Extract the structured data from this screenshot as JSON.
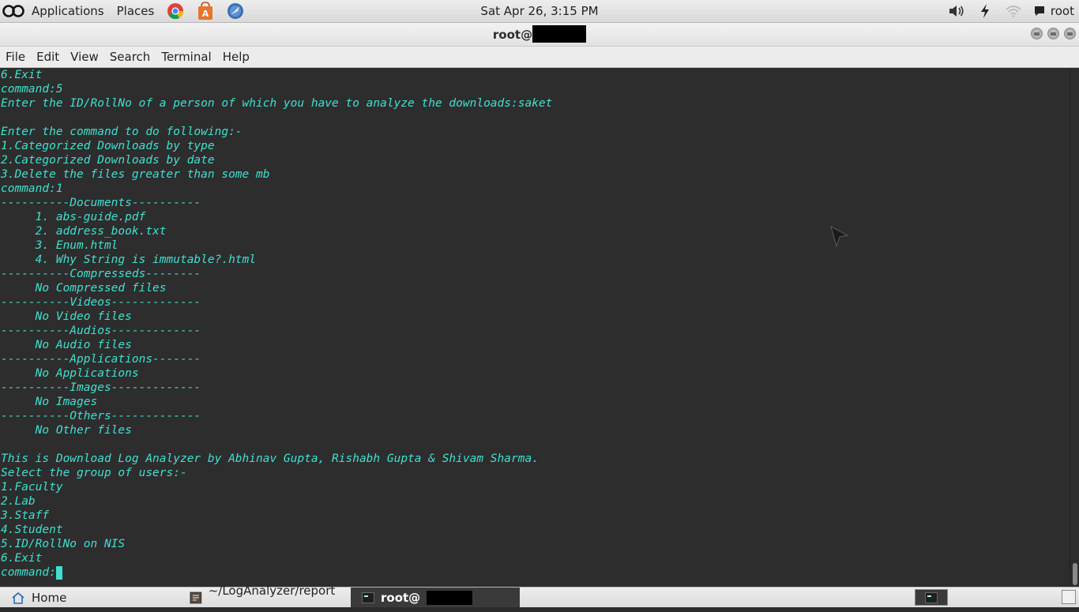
{
  "top_panel": {
    "menus": [
      "Applications",
      "Places"
    ],
    "launchers": [
      "chrome-icon",
      "software-center-icon",
      "network-globe-icon"
    ],
    "clock": "Sat Apr 26,  3:15 PM",
    "user": "root"
  },
  "window": {
    "title_prefix": "root@"
  },
  "menubar": {
    "items": [
      "File",
      "Edit",
      "View",
      "Search",
      "Terminal",
      "Help"
    ]
  },
  "terminal": {
    "lines": [
      "6.Exit",
      "command:5",
      "Enter the ID/RollNo of a person of which you have to analyze the downloads:saket",
      "",
      "Enter the command to do following:-",
      "1.Categorized Downloads by type",
      "2.Categorized Downloads by date",
      "3.Delete the files greater than some mb",
      "command:1",
      "----------Documents----------",
      "     1. abs-guide.pdf",
      "     2. address_book.txt",
      "     3. Enum.html",
      "     4. Why String is immutable?.html",
      "----------Compresseds--------",
      "     No Compressed files",
      "----------Videos-------------",
      "     No Video files",
      "----------Audios-------------",
      "     No Audio files",
      "----------Applications-------",
      "     No Applications",
      "----------Images-------------",
      "     No Images",
      "----------Others-------------",
      "     No Other files",
      "",
      "This is Download Log Analyzer by Abhinav Gupta, Rishabh Gupta & Shivam Sharma.",
      "Select the group of users:-",
      "1.Faculty",
      "2.Lab",
      "3.Staff",
      "4.Student",
      "5.ID/RollNo on NIS",
      "6.Exit",
      "command:"
    ],
    "text_color": "#3fe0d0",
    "background": "#2d2d2d"
  },
  "taskbar": {
    "home_label": "Home",
    "report_label": "~/LogAnalyzer/report ...",
    "terminal_label": "root@"
  }
}
